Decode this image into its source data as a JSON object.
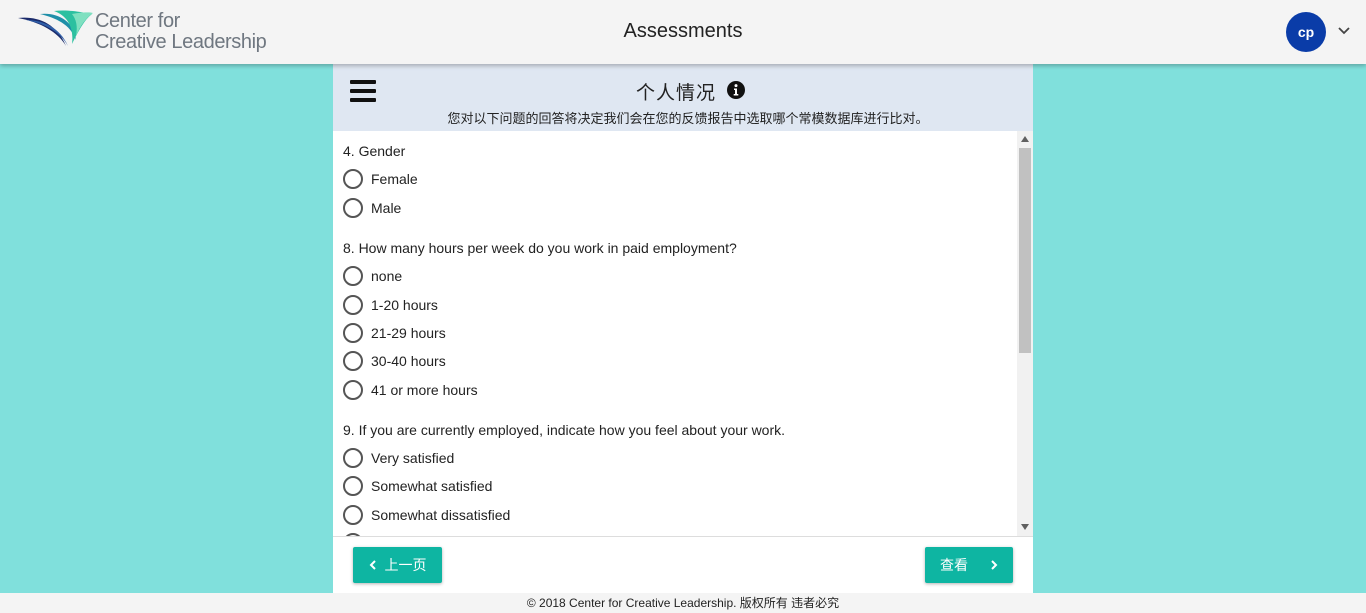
{
  "header": {
    "logo_line1": "Center for",
    "logo_line2": "Creative Leadership",
    "title": "Assessments",
    "user_initials": "cp",
    "brand_color": "#0a3ca8"
  },
  "section": {
    "title": "个人情况",
    "subtitle": "您对以下问题的回答将决定我们会在您的反馈报告中选取哪个常模数据库进行比对。"
  },
  "questions": [
    {
      "label": "4. Gender",
      "options": [
        "Female",
        "Male"
      ],
      "selected": null
    },
    {
      "label": "8. How many hours per week do you work in paid employment?",
      "options": [
        "none",
        "1-20 hours",
        "21-29 hours",
        "30-40 hours",
        "41 or more hours"
      ],
      "selected": null
    },
    {
      "label": "9. If you are currently employed, indicate how you feel about your work.",
      "options": [
        "Very satisfied",
        "Somewhat satisfied",
        "Somewhat dissatisfied"
      ],
      "selected": null
    }
  ],
  "nav": {
    "prev_label": "上一页",
    "next_label": "查看",
    "button_color": "#0eb5a2"
  },
  "footer": {
    "copyright": "© 2018 Center for Creative Leadership. 版权所有 违者必究"
  },
  "colors": {
    "background": "#80e0dc",
    "panel_header": "#dfe7f2"
  }
}
